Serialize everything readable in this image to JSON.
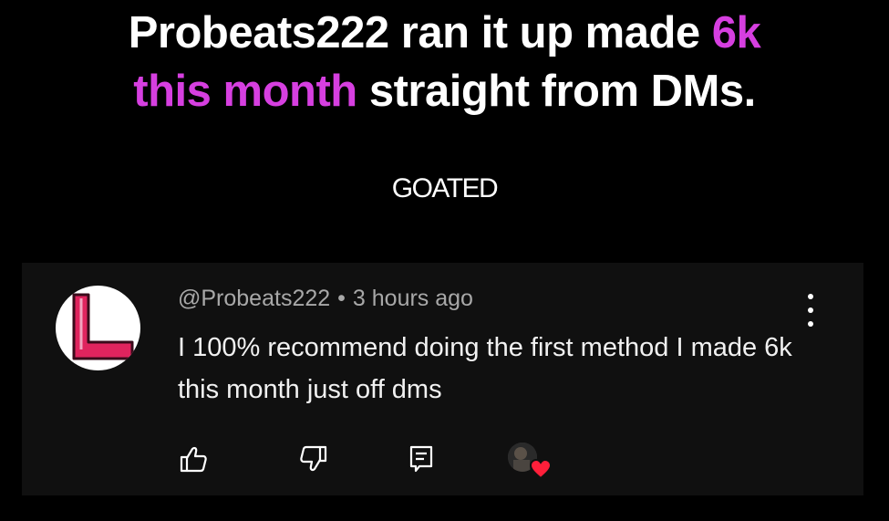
{
  "headline": {
    "part1": "Probeats222 ran it up made ",
    "accent1": "6k",
    "accent2": "this month",
    "part2": " straight from DMs."
  },
  "subtitle": "GOATED",
  "comment": {
    "author": "@Probeats222",
    "separator": "•",
    "time": "3 hours ago",
    "text": "I 100% recommend doing the first method I made 6k this month just off dms",
    "avatar_icon": "letter-l-logo-icon",
    "actions": [
      "like-icon",
      "dislike-icon",
      "reply-icon"
    ],
    "creator_heart": true
  },
  "colors": {
    "accent": "#d63fe0",
    "avatar_red": "#e0245e",
    "heart": "#ff1f3a",
    "card_bg": "#101010"
  }
}
